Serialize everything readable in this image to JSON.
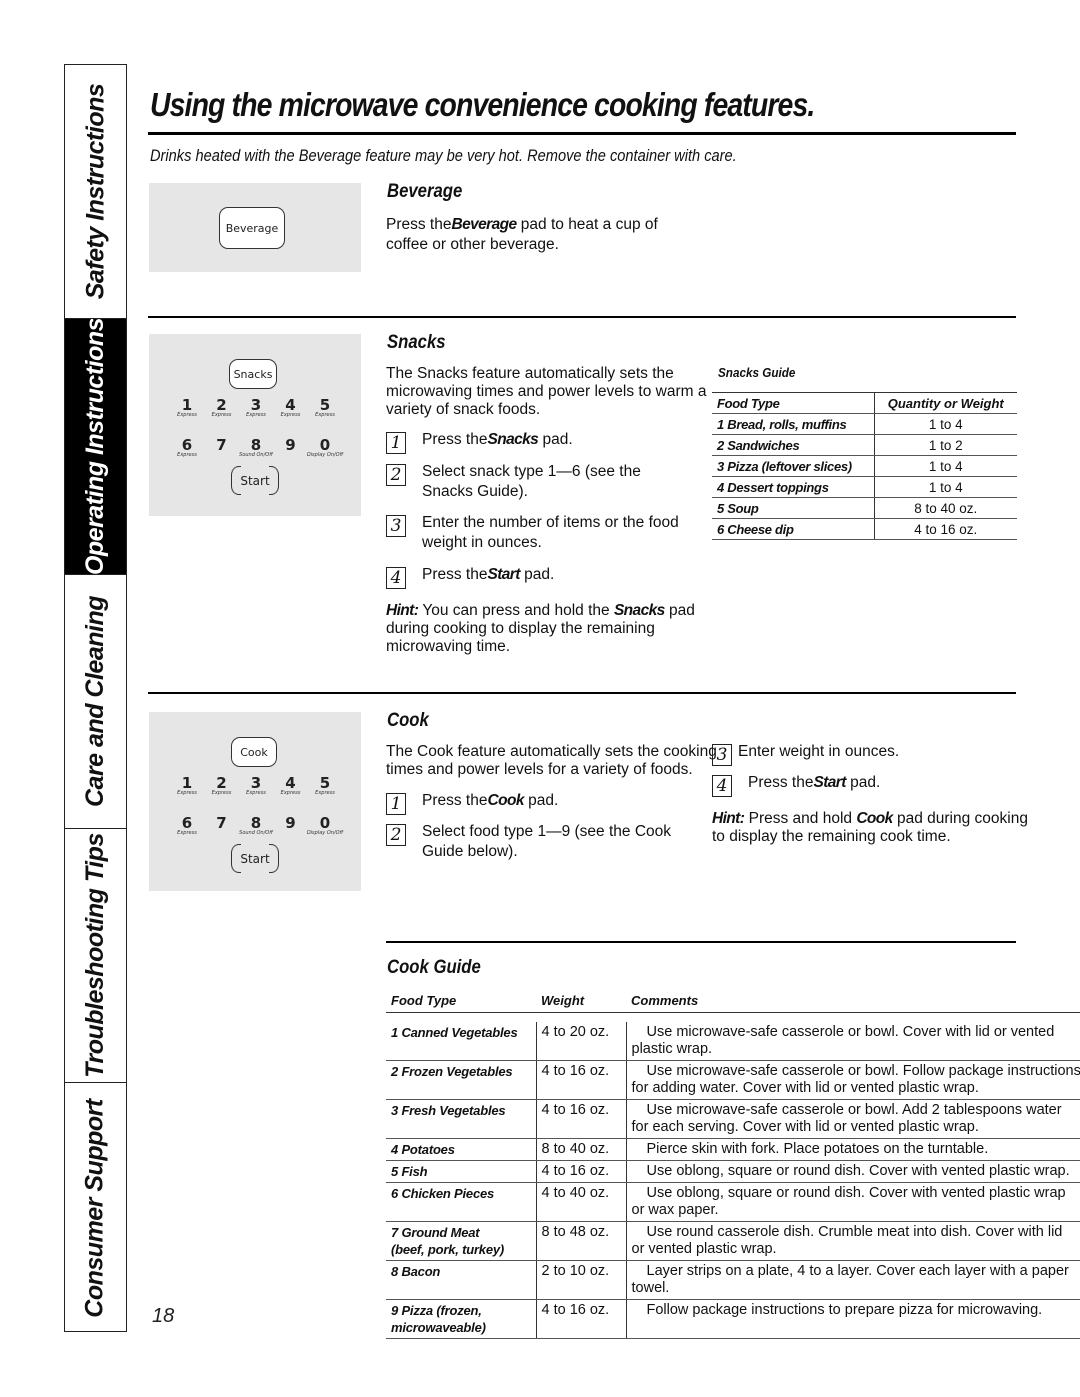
{
  "side_tabs": [
    {
      "label": "Safety Instructions",
      "active": false
    },
    {
      "label": "Operating Instructions",
      "active": true
    },
    {
      "label": "Care and Cleaning",
      "active": false
    },
    {
      "label": "Troubleshooting Tips",
      "active": false
    },
    {
      "label": "Consumer Support",
      "active": false
    }
  ],
  "header": {
    "title": "Using the microwave convenience cooking features.",
    "warning": "Drinks heated with the Beverage feature may be very hot. Remove the container with care."
  },
  "beverage": {
    "pad_label": "Beverage",
    "heading": "Beverage",
    "text_pre": "Press the",
    "text_bold": "Beverage",
    "text_post": " pad to heat a cup of coffee or other beverage."
  },
  "keypad": {
    "row1": [
      {
        "num": "1",
        "sub": "Express"
      },
      {
        "num": "2",
        "sub": "Express"
      },
      {
        "num": "3",
        "sub": "Express"
      },
      {
        "num": "4",
        "sub": "Express"
      },
      {
        "num": "5",
        "sub": "Express"
      }
    ],
    "row2": [
      {
        "num": "6",
        "sub": "Express"
      },
      {
        "num": "7",
        "sub": ""
      },
      {
        "num": "8",
        "sub": "Sound On/Off"
      },
      {
        "num": "9",
        "sub": ""
      },
      {
        "num": "0",
        "sub": "Display On/Off"
      }
    ],
    "start_label": "Start"
  },
  "snacks": {
    "pad_label": "Snacks",
    "heading": "Snacks",
    "intro": "The Snacks feature automatically sets the microwaving times and power levels to warm a variety of snack foods.",
    "steps": [
      {
        "num": "1",
        "pre": "Press the",
        "bold": "Snacks",
        "post": " pad."
      },
      {
        "num": "2",
        "pre": "Select snack type 1—6 (see the Snacks Guide).",
        "bold": "",
        "post": ""
      },
      {
        "num": "3",
        "pre": "Enter the number of items or the food weight in ounces.",
        "bold": "",
        "post": ""
      },
      {
        "num": "4",
        "pre": "Press the",
        "bold": "Start",
        "post": " pad."
      }
    ],
    "hint_label": "Hint:",
    "hint_pre": " You can press and hold the ",
    "hint_bold": "Snacks",
    "hint_post": " pad during cooking to display the remaining microwaving time."
  },
  "snacks_guide": {
    "title": "Snacks Guide",
    "headers": [
      "Food Type",
      "Quantity or Weight"
    ],
    "rows": [
      [
        "1 Bread, rolls, muffins",
        "1 to 4"
      ],
      [
        "2 Sandwiches",
        "1 to 2"
      ],
      [
        "3 Pizza (leftover slices)",
        "1 to 4"
      ],
      [
        "4 Dessert toppings",
        "1 to 4"
      ],
      [
        "5 Soup",
        "8 to 40 oz."
      ],
      [
        "6 Cheese dip",
        "4 to 16 oz."
      ]
    ]
  },
  "cook": {
    "pad_label": "Cook",
    "heading": "Cook",
    "intro": "The Cook feature automatically sets the cooking times and power levels for a variety of foods.",
    "steps": [
      {
        "num": "1",
        "pre": "Press the",
        "bold": "Cook",
        "post": " pad."
      },
      {
        "num": "2",
        "pre": "Select food type 1—9 (see the Cook Guide below).",
        "bold": "",
        "post": ""
      },
      {
        "num": "3",
        "pre": "Enter weight in ounces.",
        "bold": "",
        "post": ""
      },
      {
        "num": "4",
        "pre": "Press the",
        "bold": "Start",
        "post": " pad."
      }
    ],
    "hint_label": "Hint:",
    "hint_pre": " Press and hold ",
    "hint_bold": "Cook",
    "hint_post": " pad during cooking to display the remaining cook time."
  },
  "cook_guide": {
    "title": "Cook Guide",
    "headers": [
      "Food Type",
      "Weight",
      "Comments"
    ],
    "rows": [
      {
        "food": [
          "1 Canned Vegetables"
        ],
        "weight": "4 to 20 oz.",
        "comments": [
          "Use microwave-safe casserole or bowl. Cover with lid or vented",
          "plastic wrap."
        ]
      },
      {
        "food": [
          "2 Frozen Vegetables"
        ],
        "weight": "4 to 16 oz.",
        "comments": [
          "Use microwave-safe casserole or bowl. Follow package instructions",
          "for adding water. Cover with lid or vented plastic wrap."
        ]
      },
      {
        "food": [
          "3 Fresh Vegetables"
        ],
        "weight": "4 to 16 oz.",
        "comments": [
          "Use microwave-safe casserole or bowl. Add 2 tablespoons water",
          "for each serving. Cover with lid or vented plastic wrap."
        ]
      },
      {
        "food": [
          "4 Potatoes"
        ],
        "weight": "8 to 40 oz.",
        "comments": [
          "Pierce skin with fork. Place potatoes on the turntable."
        ]
      },
      {
        "food": [
          "5 Fish"
        ],
        "weight": "4 to 16 oz.",
        "comments": [
          "Use oblong, square or round dish. Cover with vented plastic wrap."
        ]
      },
      {
        "food": [
          "6 Chicken Pieces"
        ],
        "weight": "4 to 40 oz.",
        "comments": [
          "Use oblong, square or round dish. Cover with vented plastic wrap",
          "or wax paper."
        ]
      },
      {
        "food": [
          "7 Ground Meat",
          "(beef, pork, turkey)"
        ],
        "weight": "8 to 48 oz.",
        "comments": [
          "Use round casserole dish. Crumble meat into dish. Cover with lid",
          "or vented plastic wrap."
        ]
      },
      {
        "food": [
          "8 Bacon"
        ],
        "weight": "2 to 10 oz.",
        "comments": [
          "Layer strips on a plate, 4 to a layer. Cover each layer with a paper",
          "towel."
        ]
      },
      {
        "food": [
          "9 Pizza (frozen,",
          "microwaveable)"
        ],
        "weight": "4 to 16 oz.",
        "comments": [
          "Follow package instructions to prepare pizza for microwaving."
        ]
      }
    ]
  },
  "page_number": "18"
}
